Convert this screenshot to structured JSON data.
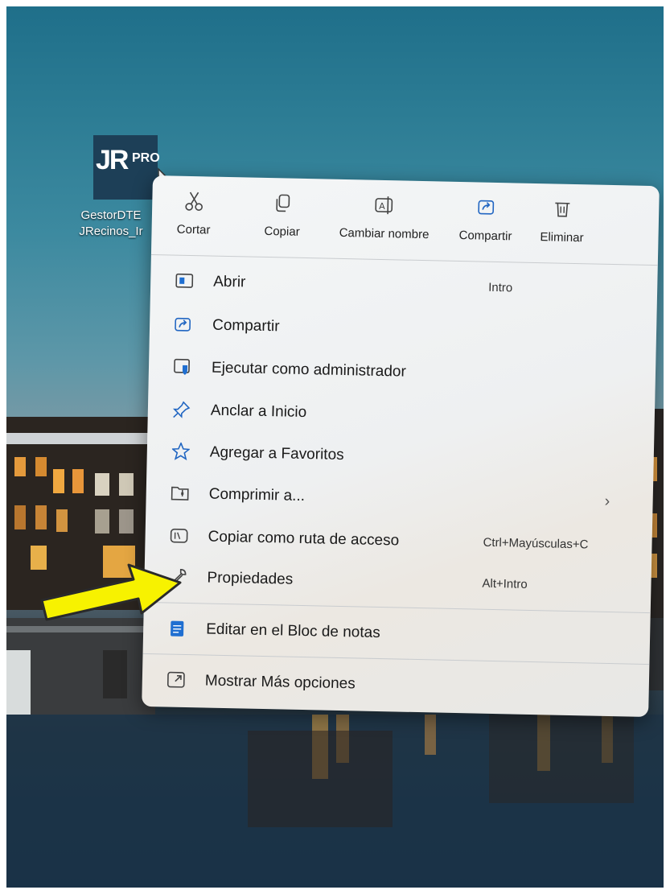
{
  "desktop": {
    "icon_text_main": "JR",
    "icon_text_sub": "PRO",
    "label_line1": "GestorDTE",
    "label_line2": "JRecinos_Ir"
  },
  "toolbar": [
    {
      "label": "Cortar",
      "icon": "scissors-icon"
    },
    {
      "label": "Copiar",
      "icon": "copy-icon"
    },
    {
      "label": "Cambiar nombre",
      "icon": "rename-icon"
    },
    {
      "label": "Compartir",
      "icon": "share-icon"
    },
    {
      "label": "Eliminar",
      "icon": "trash-icon"
    }
  ],
  "menu": {
    "items": [
      {
        "label": "Abrir",
        "shortcut": "Intro",
        "icon": "open-window-icon"
      },
      {
        "label": "Compartir",
        "shortcut": "",
        "icon": "share-icon"
      },
      {
        "label": "Ejecutar como administrador",
        "shortcut": "",
        "icon": "admin-shield-icon"
      },
      {
        "label": "Anclar a Inicio",
        "shortcut": "",
        "icon": "pin-icon"
      },
      {
        "label": "Agregar a Favoritos",
        "shortcut": "",
        "icon": "star-icon"
      },
      {
        "label": "Comprimir a...",
        "shortcut": "",
        "icon": "zip-folder-icon",
        "submenu": true
      },
      {
        "label": "Copiar como ruta de acceso",
        "shortcut": "Ctrl+Mayúsculas+C",
        "icon": "path-icon"
      },
      {
        "label": "Propiedades",
        "shortcut": "Alt+Intro",
        "icon": "wrench-icon"
      },
      {
        "label": "Editar en el Bloc de notas",
        "shortcut": "",
        "icon": "notepad-icon"
      },
      {
        "label": "Mostrar Más opciones",
        "shortcut": "",
        "icon": "more-options-icon"
      }
    ],
    "submenu_chevron": "›"
  },
  "colors": {
    "menu_bg": "#f0f2f3",
    "accent": "#1f6fd1",
    "arrow": "#f7f200"
  }
}
